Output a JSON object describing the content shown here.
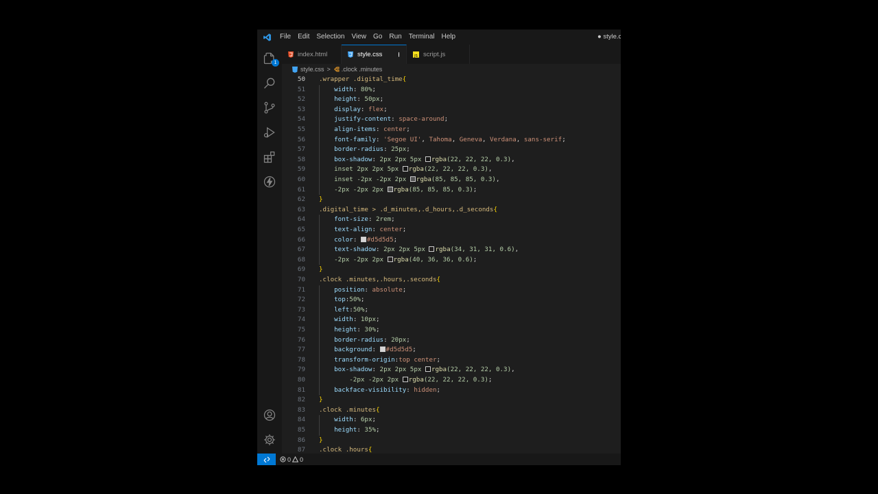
{
  "menu": [
    "File",
    "Edit",
    "Selection",
    "View",
    "Go",
    "Run",
    "Terminal",
    "Help"
  ],
  "window_title": "● style.css",
  "tabs": [
    {
      "label": "index.html",
      "icon": "html-file-icon",
      "active": false
    },
    {
      "label": "style.css",
      "icon": "css-file-icon",
      "active": true,
      "modified": true
    },
    {
      "label": "script.js",
      "icon": "js-file-icon",
      "active": false
    }
  ],
  "breadcrumb": {
    "file": "style.css",
    "separator": ">",
    "symbol": ".clock .minutes"
  },
  "explorer_badge": "1",
  "status": {
    "errors": "0",
    "warnings": "0"
  },
  "colors": {
    "accent": "#0078d4",
    "editor_bg": "#1e1e1e",
    "swatch_d5": "#d5d5d5"
  },
  "code_lines": [
    {
      "n": "50",
      "tokens": [
        [
          ".wrapper .digital_time",
          "sel"
        ],
        [
          "{",
          "brace"
        ]
      ]
    },
    {
      "n": "51",
      "tokens": [
        [
          "    ",
          ""
        ],
        [
          "width",
          "prop"
        ],
        [
          ": ",
          "pun"
        ],
        [
          "80%",
          "num"
        ],
        [
          ";",
          "pun"
        ]
      ]
    },
    {
      "n": "52",
      "tokens": [
        [
          "    ",
          ""
        ],
        [
          "height",
          "prop"
        ],
        [
          ": ",
          "pun"
        ],
        [
          "50px",
          "num"
        ],
        [
          ";",
          "pun"
        ]
      ]
    },
    {
      "n": "53",
      "tokens": [
        [
          "    ",
          ""
        ],
        [
          "display",
          "prop"
        ],
        [
          ": ",
          "pun"
        ],
        [
          "flex",
          "val"
        ],
        [
          ";",
          "pun"
        ]
      ]
    },
    {
      "n": "54",
      "tokens": [
        [
          "    ",
          ""
        ],
        [
          "justify-content",
          "prop"
        ],
        [
          ": ",
          "pun"
        ],
        [
          "space-around",
          "val"
        ],
        [
          ";",
          "pun"
        ]
      ]
    },
    {
      "n": "55",
      "tokens": [
        [
          "    ",
          ""
        ],
        [
          "align-items",
          "prop"
        ],
        [
          ": ",
          "pun"
        ],
        [
          "center",
          "val"
        ],
        [
          ";",
          "pun"
        ]
      ]
    },
    {
      "n": "56",
      "tokens": [
        [
          "    ",
          ""
        ],
        [
          "font-family",
          "prop"
        ],
        [
          ": ",
          "pun"
        ],
        [
          "'Segoe UI'",
          "val"
        ],
        [
          ", ",
          "pun"
        ],
        [
          "Tahoma",
          "val"
        ],
        [
          ", ",
          "pun"
        ],
        [
          "Geneva",
          "val"
        ],
        [
          ", ",
          "pun"
        ],
        [
          "Verdana",
          "val"
        ],
        [
          ", ",
          "pun"
        ],
        [
          "sans-serif",
          "val"
        ],
        [
          ";",
          "pun"
        ]
      ]
    },
    {
      "n": "57",
      "tokens": [
        [
          "    ",
          ""
        ],
        [
          "border-radius",
          "prop"
        ],
        [
          ": ",
          "pun"
        ],
        [
          "25px",
          "num"
        ],
        [
          ";",
          "pun"
        ]
      ]
    },
    {
      "n": "58",
      "tokens": [
        [
          "    ",
          ""
        ],
        [
          "box-shadow",
          "prop"
        ],
        [
          ": ",
          "pun"
        ],
        [
          "2px 2px 5px ",
          "num"
        ],
        [
          "#161616",
          "swatch"
        ],
        [
          "rgba",
          "fn"
        ],
        [
          "(22, 22, 22, 0.3)",
          "num"
        ],
        [
          ",",
          "pun"
        ]
      ]
    },
    {
      "n": "59",
      "tokens": [
        [
          "    ",
          ""
        ],
        [
          "inset 2px 2px 5px ",
          "num"
        ],
        [
          "#161616",
          "swatch"
        ],
        [
          "rgba",
          "fn"
        ],
        [
          "(22, 22, 22, 0.3)",
          "num"
        ],
        [
          ",",
          "pun"
        ]
      ]
    },
    {
      "n": "60",
      "tokens": [
        [
          "    ",
          ""
        ],
        [
          "inset -2px -2px 2px ",
          "num"
        ],
        [
          "#555555",
          "swatch"
        ],
        [
          "rgba",
          "fn"
        ],
        [
          "(85, 85, 85, 0.3)",
          "num"
        ],
        [
          ",",
          "pun"
        ]
      ]
    },
    {
      "n": "61",
      "tokens": [
        [
          "    ",
          ""
        ],
        [
          "-2px -2px 2px ",
          "num"
        ],
        [
          "#555555",
          "swatch"
        ],
        [
          "rgba",
          "fn"
        ],
        [
          "(85, 85, 85, 0.3)",
          "num"
        ],
        [
          ";",
          "pun"
        ]
      ]
    },
    {
      "n": "62",
      "tokens": [
        [
          "}",
          "brace"
        ]
      ]
    },
    {
      "n": "63",
      "tokens": [
        [
          ".digital_time > .d_minutes,.d_hours,.d_seconds",
          "sel"
        ],
        [
          "{",
          "brace"
        ]
      ]
    },
    {
      "n": "64",
      "tokens": [
        [
          "    ",
          ""
        ],
        [
          "font-size",
          "prop"
        ],
        [
          ": ",
          "pun"
        ],
        [
          "2rem",
          "num"
        ],
        [
          ";",
          "pun"
        ]
      ]
    },
    {
      "n": "65",
      "tokens": [
        [
          "    ",
          ""
        ],
        [
          "text-align",
          "prop"
        ],
        [
          ": ",
          "pun"
        ],
        [
          "center",
          "val"
        ],
        [
          ";",
          "pun"
        ]
      ]
    },
    {
      "n": "66",
      "tokens": [
        [
          "    ",
          ""
        ],
        [
          "color",
          "prop"
        ],
        [
          ": ",
          "pun"
        ],
        [
          "#d5d5d5",
          "swatch-fill"
        ],
        [
          "#d5d5d5",
          "val"
        ],
        [
          ";",
          "pun"
        ]
      ]
    },
    {
      "n": "67",
      "tokens": [
        [
          "    ",
          ""
        ],
        [
          "text-shadow",
          "prop"
        ],
        [
          ": ",
          "pun"
        ],
        [
          "2px 2px 5px ",
          "num"
        ],
        [
          "#221f1f",
          "swatch"
        ],
        [
          "rgba",
          "fn"
        ],
        [
          "(34, 31, 31, 0.6)",
          "num"
        ],
        [
          ",",
          "pun"
        ]
      ]
    },
    {
      "n": "68",
      "tokens": [
        [
          "    ",
          ""
        ],
        [
          "-2px -2px 2px ",
          "num"
        ],
        [
          "#282424",
          "swatch"
        ],
        [
          "rgba",
          "fn"
        ],
        [
          "(40, 36, 36, 0.6)",
          "num"
        ],
        [
          ";",
          "pun"
        ]
      ]
    },
    {
      "n": "69",
      "tokens": [
        [
          "}",
          "brace"
        ]
      ]
    },
    {
      "n": "70",
      "tokens": [
        [
          ".clock .minutes,.hours,.seconds",
          "sel"
        ],
        [
          "{",
          "brace"
        ]
      ]
    },
    {
      "n": "71",
      "tokens": [
        [
          "    ",
          ""
        ],
        [
          "position",
          "prop"
        ],
        [
          ": ",
          "pun"
        ],
        [
          "absolute",
          "val"
        ],
        [
          ";",
          "pun"
        ]
      ]
    },
    {
      "n": "72",
      "tokens": [
        [
          "    ",
          ""
        ],
        [
          "top",
          "prop"
        ],
        [
          ":",
          "pun"
        ],
        [
          "50%",
          "num"
        ],
        [
          ";",
          "pun"
        ]
      ]
    },
    {
      "n": "73",
      "tokens": [
        [
          "    ",
          ""
        ],
        [
          "left",
          "prop"
        ],
        [
          ":",
          "pun"
        ],
        [
          "50%",
          "num"
        ],
        [
          ";",
          "pun"
        ]
      ]
    },
    {
      "n": "74",
      "tokens": [
        [
          "    ",
          ""
        ],
        [
          "width",
          "prop"
        ],
        [
          ": ",
          "pun"
        ],
        [
          "10px",
          "num"
        ],
        [
          ";",
          "pun"
        ]
      ]
    },
    {
      "n": "75",
      "tokens": [
        [
          "    ",
          ""
        ],
        [
          "height",
          "prop"
        ],
        [
          ": ",
          "pun"
        ],
        [
          "30%",
          "num"
        ],
        [
          ";",
          "pun"
        ]
      ]
    },
    {
      "n": "76",
      "tokens": [
        [
          "    ",
          ""
        ],
        [
          "border-radius",
          "prop"
        ],
        [
          ": ",
          "pun"
        ],
        [
          "20px",
          "num"
        ],
        [
          ";",
          "pun"
        ]
      ]
    },
    {
      "n": "77",
      "tokens": [
        [
          "    ",
          ""
        ],
        [
          "background",
          "prop"
        ],
        [
          ": ",
          "pun"
        ],
        [
          "#d5d5d5",
          "swatch-fill"
        ],
        [
          "#d5d5d5",
          "val"
        ],
        [
          ";",
          "pun"
        ]
      ]
    },
    {
      "n": "78",
      "tokens": [
        [
          "    ",
          ""
        ],
        [
          "transform-origin",
          "prop"
        ],
        [
          ":",
          "pun"
        ],
        [
          "top center",
          "val"
        ],
        [
          ";",
          "pun"
        ]
      ]
    },
    {
      "n": "79",
      "tokens": [
        [
          "    ",
          ""
        ],
        [
          "box-shadow",
          "prop"
        ],
        [
          ": ",
          "pun"
        ],
        [
          "2px 2px 5px ",
          "num"
        ],
        [
          "#161616",
          "swatch"
        ],
        [
          "rgba",
          "fn"
        ],
        [
          "(22, 22, 22, 0.3)",
          "num"
        ],
        [
          ",",
          "pun"
        ]
      ]
    },
    {
      "n": "80",
      "tokens": [
        [
          "        ",
          ""
        ],
        [
          "-2px -2px 2px ",
          "num"
        ],
        [
          "#161616",
          "swatch"
        ],
        [
          "rgba",
          "fn"
        ],
        [
          "(22, 22, 22, 0.3)",
          "num"
        ],
        [
          ";",
          "pun"
        ]
      ]
    },
    {
      "n": "81",
      "tokens": [
        [
          "    ",
          ""
        ],
        [
          "backface-visibility",
          "prop"
        ],
        [
          ": ",
          "pun"
        ],
        [
          "hidden",
          "val"
        ],
        [
          ";",
          "pun"
        ]
      ]
    },
    {
      "n": "82",
      "tokens": [
        [
          "}",
          "brace"
        ]
      ]
    },
    {
      "n": "83",
      "tokens": [
        [
          ".clock .minutes",
          "sel"
        ],
        [
          "{",
          "brace"
        ]
      ]
    },
    {
      "n": "84",
      "tokens": [
        [
          "    ",
          ""
        ],
        [
          "width",
          "prop"
        ],
        [
          ": ",
          "pun"
        ],
        [
          "6px",
          "num"
        ],
        [
          ";",
          "pun"
        ]
      ]
    },
    {
      "n": "85",
      "tokens": [
        [
          "    ",
          ""
        ],
        [
          "height",
          "prop"
        ],
        [
          ": ",
          "pun"
        ],
        [
          "35%",
          "num"
        ],
        [
          ";",
          "pun"
        ]
      ]
    },
    {
      "n": "86",
      "tokens": [
        [
          "}",
          "brace"
        ]
      ]
    },
    {
      "n": "87",
      "tokens": [
        [
          ".clock .hours",
          "sel"
        ],
        [
          "{",
          "brace"
        ]
      ]
    }
  ]
}
